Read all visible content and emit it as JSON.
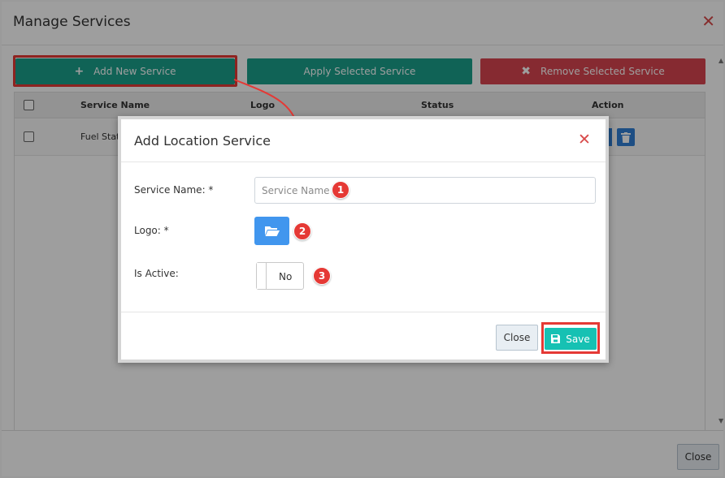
{
  "outer": {
    "title": "Manage Services",
    "add_label": "Add New Service",
    "apply_label": "Apply Selected Service",
    "remove_label": "Remove Selected Service",
    "close_label": "Close",
    "columns": [
      "Service Name",
      "Logo",
      "Status",
      "Action"
    ],
    "rows": [
      {
        "service_name": "Fuel Statio"
      }
    ]
  },
  "modal": {
    "title": "Add Location Service",
    "service_name_label": "Service Name: *",
    "service_name_placeholder": "Service Name",
    "service_name_value": "",
    "logo_label": "Logo: *",
    "active_label": "Is Active:",
    "active_value": "No",
    "close_label": "Close",
    "save_label": "Save"
  },
  "annotations": [
    "1",
    "2",
    "3"
  ],
  "colors": {
    "teal": "#1aa08c",
    "red": "#d9454f",
    "blue": "#4196ee",
    "save": "#16c1b3",
    "highlight": "#e53935"
  }
}
